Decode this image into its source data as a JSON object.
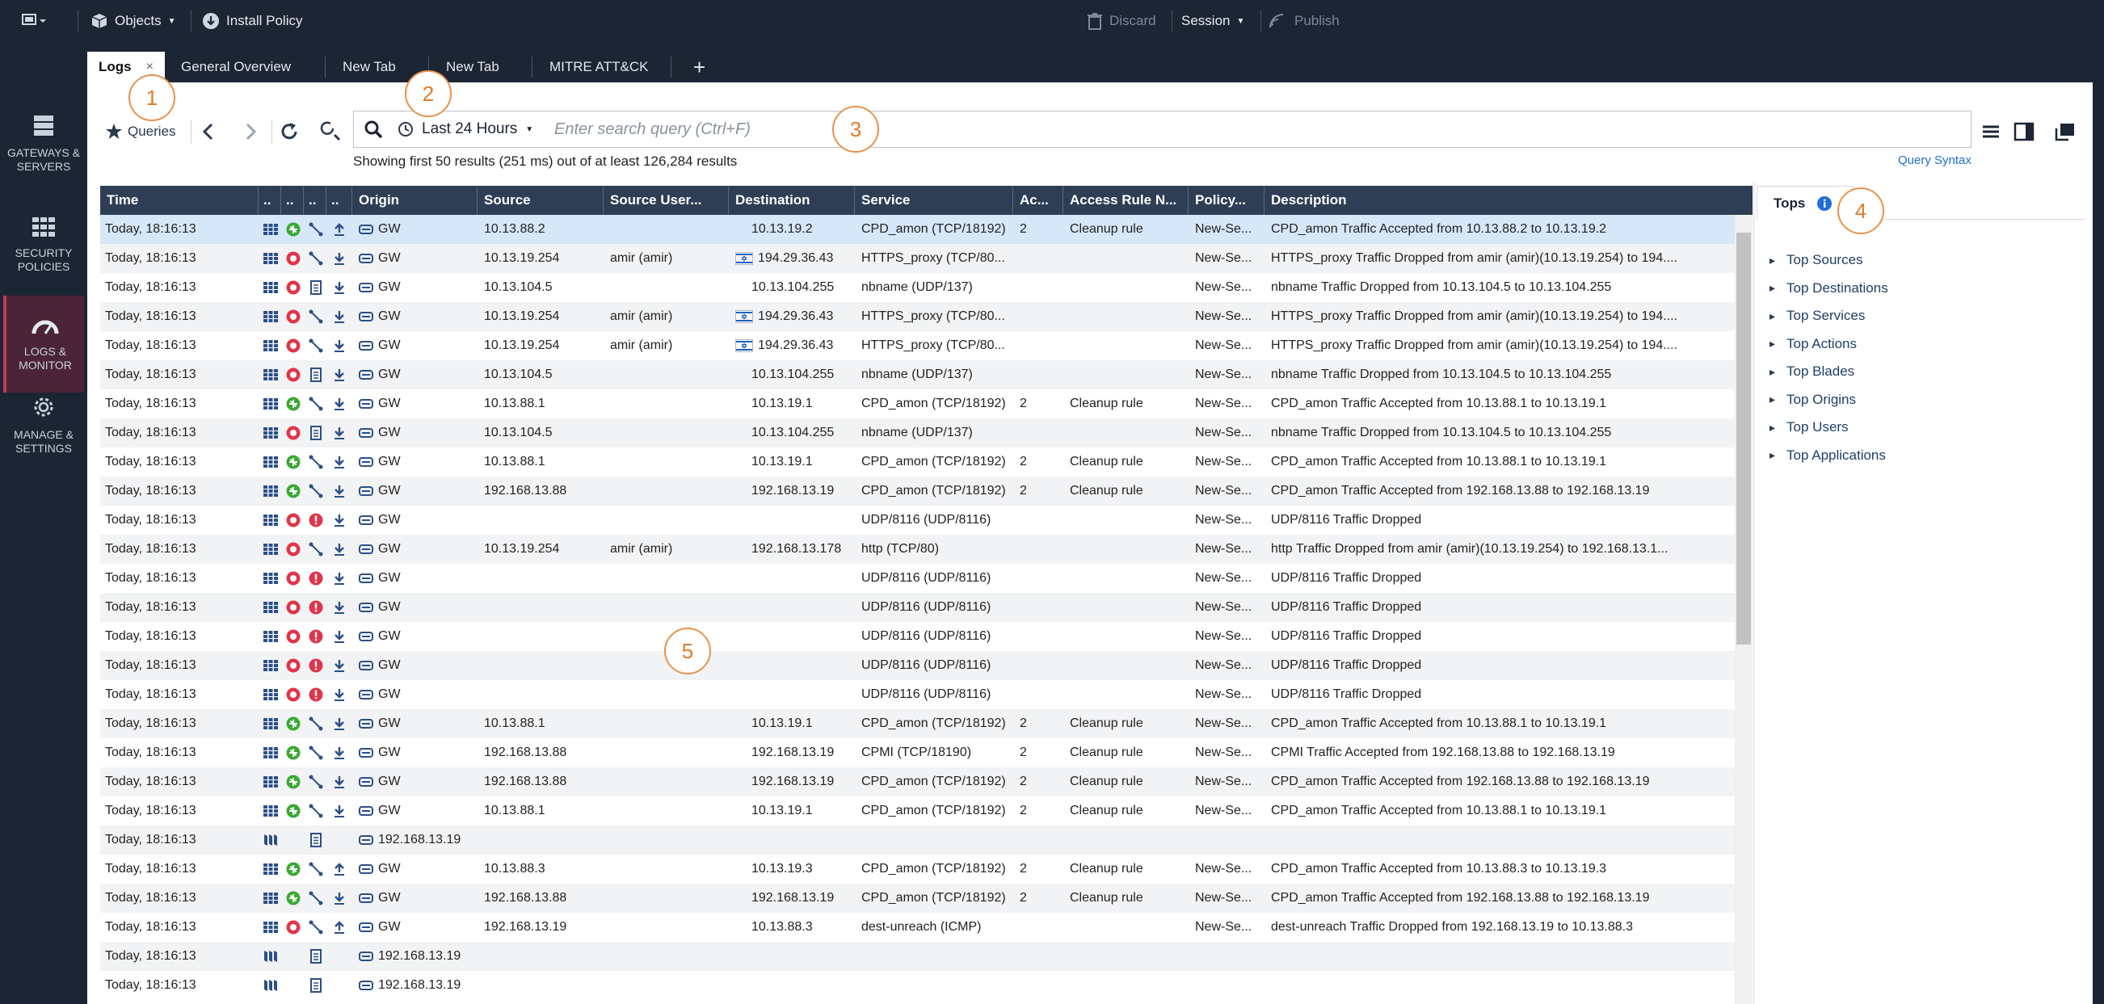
{
  "topbar": {
    "objects_label": "Objects",
    "install_policy_label": "Install Policy",
    "discard_label": "Discard",
    "session_label": "Session",
    "publish_label": "Publish"
  },
  "tabs": [
    {
      "label": "Logs",
      "close": "×"
    },
    {
      "label": "General Overview"
    },
    {
      "label": "New Tab"
    },
    {
      "label": "New Tab"
    },
    {
      "label": "MITRE ATT&CK"
    }
  ],
  "add_tab": "+",
  "sidebar": [
    {
      "label": "GATEWAYS & SERVERS",
      "icon": "gateways-icon"
    },
    {
      "label": "SECURITY POLICIES",
      "icon": "policies-icon"
    },
    {
      "label": "LOGS & MONITOR",
      "icon": "monitor-icon"
    },
    {
      "label": "MANAGE & SETTINGS",
      "icon": "gear-icon"
    }
  ],
  "toolbar": {
    "queries_label": "Queries",
    "timeframe_label": "Last 24 Hours",
    "search_placeholder": "Enter search query (Ctrl+F)",
    "results_text": "Showing first 50 results (251 ms) out of at least 126,284 results",
    "query_syntax_label": "Query Syntax"
  },
  "callouts": [
    "1",
    "2",
    "3",
    "4",
    "5"
  ],
  "columns": [
    "Time",
    "..",
    "..",
    "..",
    "..",
    "Origin",
    "Source",
    "Source User...",
    "Destination",
    "Service",
    "Ac...",
    "Access Rule N...",
    "Policy...",
    "Description"
  ],
  "rows": [
    {
      "time": "Today, 18:16:13",
      "blade": "fw",
      "action": "accept",
      "type": "conn",
      "dir": "up",
      "origin": "GW",
      "source": "10.13.88.2",
      "user": "",
      "flag": false,
      "dest": "10.13.19.2",
      "service": "CPD_amon (TCP/18192)",
      "ac": "2",
      "rule": "Cleanup rule",
      "policy": "New-Se...",
      "desc": "CPD_amon Traffic Accepted from 10.13.88.2 to 10.13.19.2"
    },
    {
      "time": "Today, 18:16:13",
      "blade": "fw",
      "action": "drop",
      "type": "conn",
      "dir": "down",
      "origin": "GW",
      "source": "10.13.19.254",
      "user": "amir (amir)",
      "flag": true,
      "dest": "194.29.36.43",
      "service": "HTTPS_proxy (TCP/80...",
      "ac": "",
      "rule": "",
      "policy": "New-Se...",
      "desc": "HTTPS_proxy Traffic Dropped from amir (amir)(10.13.19.254) to 194...."
    },
    {
      "time": "Today, 18:16:13",
      "blade": "fw",
      "action": "drop",
      "type": "doc",
      "dir": "down",
      "origin": "GW",
      "source": "10.13.104.5",
      "user": "",
      "flag": false,
      "dest": "10.13.104.255",
      "service": "nbname (UDP/137)",
      "ac": "",
      "rule": "",
      "policy": "New-Se...",
      "desc": "nbname Traffic Dropped from 10.13.104.5 to 10.13.104.255"
    },
    {
      "time": "Today, 18:16:13",
      "blade": "fw",
      "action": "drop",
      "type": "conn",
      "dir": "down",
      "origin": "GW",
      "source": "10.13.19.254",
      "user": "amir (amir)",
      "flag": true,
      "dest": "194.29.36.43",
      "service": "HTTPS_proxy (TCP/80...",
      "ac": "",
      "rule": "",
      "policy": "New-Se...",
      "desc": "HTTPS_proxy Traffic Dropped from amir (amir)(10.13.19.254) to 194...."
    },
    {
      "time": "Today, 18:16:13",
      "blade": "fw",
      "action": "drop",
      "type": "conn",
      "dir": "down",
      "origin": "GW",
      "source": "10.13.19.254",
      "user": "amir (amir)",
      "flag": true,
      "dest": "194.29.36.43",
      "service": "HTTPS_proxy (TCP/80...",
      "ac": "",
      "rule": "",
      "policy": "New-Se...",
      "desc": "HTTPS_proxy Traffic Dropped from amir (amir)(10.13.19.254) to 194...."
    },
    {
      "time": "Today, 18:16:13",
      "blade": "fw",
      "action": "drop",
      "type": "doc",
      "dir": "down",
      "origin": "GW",
      "source": "10.13.104.5",
      "user": "",
      "flag": false,
      "dest": "10.13.104.255",
      "service": "nbname (UDP/137)",
      "ac": "",
      "rule": "",
      "policy": "New-Se...",
      "desc": "nbname Traffic Dropped from 10.13.104.5 to 10.13.104.255"
    },
    {
      "time": "Today, 18:16:13",
      "blade": "fw",
      "action": "accept",
      "type": "conn",
      "dir": "down",
      "origin": "GW",
      "source": "10.13.88.1",
      "user": "",
      "flag": false,
      "dest": "10.13.19.1",
      "service": "CPD_amon (TCP/18192)",
      "ac": "2",
      "rule": "Cleanup rule",
      "policy": "New-Se...",
      "desc": "CPD_amon Traffic Accepted from 10.13.88.1 to 10.13.19.1"
    },
    {
      "time": "Today, 18:16:13",
      "blade": "fw",
      "action": "drop",
      "type": "doc",
      "dir": "down",
      "origin": "GW",
      "source": "10.13.104.5",
      "user": "",
      "flag": false,
      "dest": "10.13.104.255",
      "service": "nbname (UDP/137)",
      "ac": "",
      "rule": "",
      "policy": "New-Se...",
      "desc": "nbname Traffic Dropped from 10.13.104.5 to 10.13.104.255"
    },
    {
      "time": "Today, 18:16:13",
      "blade": "fw",
      "action": "accept",
      "type": "conn",
      "dir": "down",
      "origin": "GW",
      "source": "10.13.88.1",
      "user": "",
      "flag": false,
      "dest": "10.13.19.1",
      "service": "CPD_amon (TCP/18192)",
      "ac": "2",
      "rule": "Cleanup rule",
      "policy": "New-Se...",
      "desc": "CPD_amon Traffic Accepted from 10.13.88.1 to 10.13.19.1"
    },
    {
      "time": "Today, 18:16:13",
      "blade": "fw",
      "action": "accept",
      "type": "conn",
      "dir": "down",
      "origin": "GW",
      "source": "192.168.13.88",
      "user": "",
      "flag": false,
      "dest": "192.168.13.19",
      "service": "CPD_amon (TCP/18192)",
      "ac": "2",
      "rule": "Cleanup rule",
      "policy": "New-Se...",
      "desc": "CPD_amon Traffic Accepted from 192.168.13.88 to 192.168.13.19"
    },
    {
      "time": "Today, 18:16:13",
      "blade": "fw",
      "action": "drop",
      "type": "alert",
      "dir": "down",
      "origin": "GW",
      "source": "",
      "user": "",
      "flag": false,
      "dest": "",
      "service": "UDP/8116 (UDP/8116)",
      "ac": "",
      "rule": "",
      "policy": "New-Se...",
      "desc": "UDP/8116 Traffic Dropped"
    },
    {
      "time": "Today, 18:16:13",
      "blade": "fw",
      "action": "drop",
      "type": "conn",
      "dir": "down",
      "origin": "GW",
      "source": "10.13.19.254",
      "user": "amir (amir)",
      "flag": false,
      "dest": "192.168.13.178",
      "service": "http (TCP/80)",
      "ac": "",
      "rule": "",
      "policy": "New-Se...",
      "desc": "http Traffic Dropped from amir (amir)(10.13.19.254) to 192.168.13.1..."
    },
    {
      "time": "Today, 18:16:13",
      "blade": "fw",
      "action": "drop",
      "type": "alert",
      "dir": "down",
      "origin": "GW",
      "source": "",
      "user": "",
      "flag": false,
      "dest": "",
      "service": "UDP/8116 (UDP/8116)",
      "ac": "",
      "rule": "",
      "policy": "New-Se...",
      "desc": "UDP/8116 Traffic Dropped"
    },
    {
      "time": "Today, 18:16:13",
      "blade": "fw",
      "action": "drop",
      "type": "alert",
      "dir": "down",
      "origin": "GW",
      "source": "",
      "user": "",
      "flag": false,
      "dest": "",
      "service": "UDP/8116 (UDP/8116)",
      "ac": "",
      "rule": "",
      "policy": "New-Se...",
      "desc": "UDP/8116 Traffic Dropped"
    },
    {
      "time": "Today, 18:16:13",
      "blade": "fw",
      "action": "drop",
      "type": "alert",
      "dir": "down",
      "origin": "GW",
      "source": "",
      "user": "",
      "flag": false,
      "dest": "",
      "service": "UDP/8116 (UDP/8116)",
      "ac": "",
      "rule": "",
      "policy": "New-Se...",
      "desc": "UDP/8116 Traffic Dropped"
    },
    {
      "time": "Today, 18:16:13",
      "blade": "fw",
      "action": "drop",
      "type": "alert",
      "dir": "down",
      "origin": "GW",
      "source": "",
      "user": "",
      "flag": false,
      "dest": "",
      "service": "UDP/8116 (UDP/8116)",
      "ac": "",
      "rule": "",
      "policy": "New-Se...",
      "desc": "UDP/8116 Traffic Dropped"
    },
    {
      "time": "Today, 18:16:13",
      "blade": "fw",
      "action": "drop",
      "type": "alert",
      "dir": "down",
      "origin": "GW",
      "source": "",
      "user": "",
      "flag": false,
      "dest": "",
      "service": "UDP/8116 (UDP/8116)",
      "ac": "",
      "rule": "",
      "policy": "New-Se...",
      "desc": "UDP/8116 Traffic Dropped"
    },
    {
      "time": "Today, 18:16:13",
      "blade": "fw",
      "action": "accept",
      "type": "conn",
      "dir": "down",
      "origin": "GW",
      "source": "10.13.88.1",
      "user": "",
      "flag": false,
      "dest": "10.13.19.1",
      "service": "CPD_amon (TCP/18192)",
      "ac": "2",
      "rule": "Cleanup rule",
      "policy": "New-Se...",
      "desc": "CPD_amon Traffic Accepted from 10.13.88.1 to 10.13.19.1"
    },
    {
      "time": "Today, 18:16:13",
      "blade": "fw",
      "action": "accept",
      "type": "conn",
      "dir": "down",
      "origin": "GW",
      "source": "192.168.13.88",
      "user": "",
      "flag": false,
      "dest": "192.168.13.19",
      "service": "CPMI (TCP/18190)",
      "ac": "2",
      "rule": "Cleanup rule",
      "policy": "New-Se...",
      "desc": "CPMI Traffic Accepted from 192.168.13.88 to 192.168.13.19"
    },
    {
      "time": "Today, 18:16:13",
      "blade": "fw",
      "action": "accept",
      "type": "conn",
      "dir": "down",
      "origin": "GW",
      "source": "192.168.13.88",
      "user": "",
      "flag": false,
      "dest": "192.168.13.19",
      "service": "CPD_amon (TCP/18192)",
      "ac": "2",
      "rule": "Cleanup rule",
      "policy": "New-Se...",
      "desc": "CPD_amon Traffic Accepted from 192.168.13.88 to 192.168.13.19"
    },
    {
      "time": "Today, 18:16:13",
      "blade": "fw",
      "action": "accept",
      "type": "conn",
      "dir": "down",
      "origin": "GW",
      "source": "10.13.88.1",
      "user": "",
      "flag": false,
      "dest": "10.13.19.1",
      "service": "CPD_amon (TCP/18192)",
      "ac": "2",
      "rule": "Cleanup rule",
      "policy": "New-Se...",
      "desc": "CPD_amon Traffic Accepted from 10.13.88.1 to 10.13.19.1"
    },
    {
      "time": "Today, 18:16:13",
      "blade": "audit",
      "action": "",
      "type": "doc",
      "dir": "",
      "origin": "192.168.13.19",
      "source": "",
      "user": "",
      "flag": false,
      "dest": "",
      "service": "",
      "ac": "",
      "rule": "",
      "policy": "",
      "desc": ""
    },
    {
      "time": "Today, 18:16:13",
      "blade": "fw",
      "action": "accept",
      "type": "conn",
      "dir": "up",
      "origin": "GW",
      "source": "10.13.88.3",
      "user": "",
      "flag": false,
      "dest": "10.13.19.3",
      "service": "CPD_amon (TCP/18192)",
      "ac": "2",
      "rule": "Cleanup rule",
      "policy": "New-Se...",
      "desc": "CPD_amon Traffic Accepted from 10.13.88.3 to 10.13.19.3"
    },
    {
      "time": "Today, 18:16:13",
      "blade": "fw",
      "action": "accept",
      "type": "conn",
      "dir": "down",
      "origin": "GW",
      "source": "192.168.13.88",
      "user": "",
      "flag": false,
      "dest": "192.168.13.19",
      "service": "CPD_amon (TCP/18192)",
      "ac": "2",
      "rule": "Cleanup rule",
      "policy": "New-Se...",
      "desc": "CPD_amon Traffic Accepted from 192.168.13.88 to 192.168.13.19"
    },
    {
      "time": "Today, 18:16:13",
      "blade": "fw",
      "action": "drop",
      "type": "conn",
      "dir": "up",
      "origin": "GW",
      "source": "192.168.13.19",
      "user": "",
      "flag": false,
      "dest": "10.13.88.3",
      "service": "dest-unreach (ICMP)",
      "ac": "",
      "rule": "",
      "policy": "New-Se...",
      "desc": "dest-unreach Traffic Dropped from 192.168.13.19 to 10.13.88.3"
    },
    {
      "time": "Today, 18:16:13",
      "blade": "audit",
      "action": "",
      "type": "doc",
      "dir": "",
      "origin": "192.168.13.19",
      "source": "",
      "user": "",
      "flag": false,
      "dest": "",
      "service": "",
      "ac": "",
      "rule": "",
      "policy": "",
      "desc": ""
    },
    {
      "time": "Today, 18:16:13",
      "blade": "audit",
      "action": "",
      "type": "doc",
      "dir": "",
      "origin": "192.168.13.19",
      "source": "",
      "user": "",
      "flag": false,
      "dest": "",
      "service": "",
      "ac": "",
      "rule": "",
      "policy": "",
      "desc": ""
    }
  ],
  "tops": {
    "tab_label": "Tops",
    "items": [
      "Top Sources",
      "Top Destinations",
      "Top Services",
      "Top Actions",
      "Top Blades",
      "Top Origins",
      "Top Users",
      "Top Applications"
    ]
  },
  "colors": {
    "accept": "#3aa935",
    "drop": "#e0354b",
    "alert": "#e0354b",
    "icon_blue": "#2b4f86",
    "accent_orange": "#e8924a",
    "header_bg": "#2e3e54",
    "selected_row": "#d6e7f8"
  }
}
